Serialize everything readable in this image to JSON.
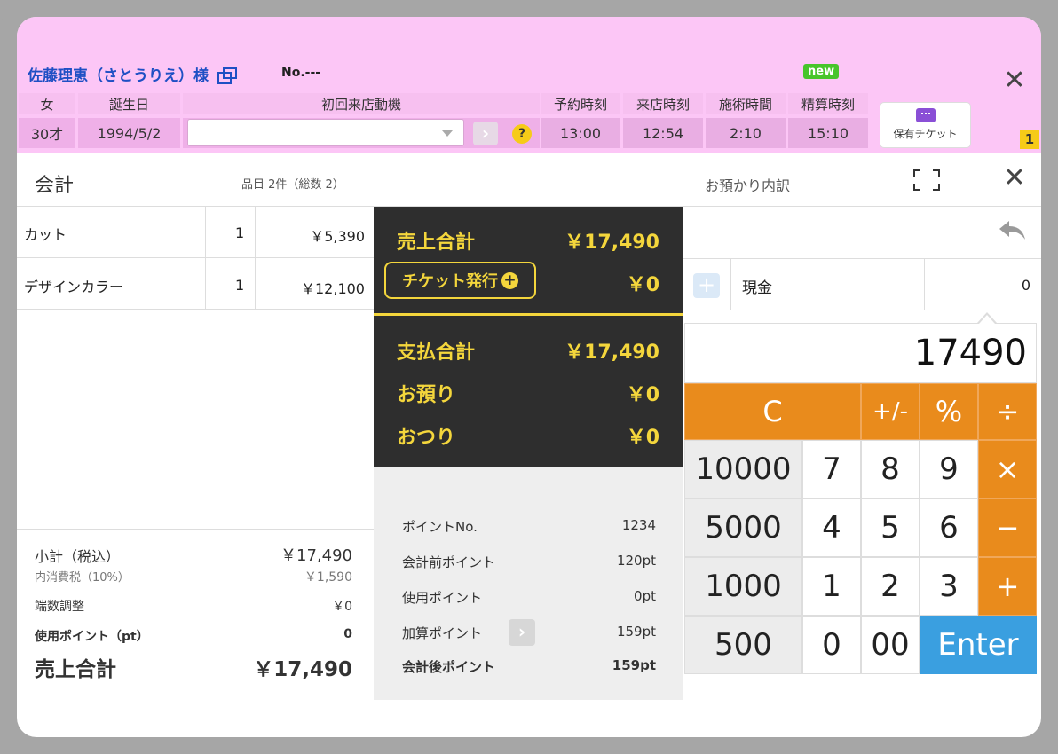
{
  "customer": {
    "name": "佐藤理恵（さとうりえ）様",
    "no": "No.---",
    "new_badge": "new",
    "headers": [
      "女",
      "誕生日",
      "初回来店動機",
      "予約時刻",
      "来店時刻",
      "施術時間",
      "精算時刻"
    ],
    "age": "30才",
    "birthday": "1994/5/2",
    "visit_motive": "",
    "reserve_time": "13:00",
    "arrival_time": "12:54",
    "treatment_time": "2:10",
    "settle_time": "15:10",
    "ticket_button": "保有チケット",
    "ticket_count": "1"
  },
  "checkout": {
    "title": "会計",
    "items_count": "品目 2件（総数 2）",
    "deposit_title": "お預かり内訳",
    "items": [
      {
        "name": "カット",
        "qty": "1",
        "price": "￥5,390"
      },
      {
        "name": "デザインカラー",
        "qty": "1",
        "price": "￥12,100"
      }
    ],
    "summary": {
      "subtotal_label": "小計（税込）",
      "subtotal": "￥17,490",
      "tax_label": "内消費税（10%）",
      "tax": "￥1,590",
      "rounding_label": "端数調整",
      "rounding": "￥0",
      "used_points_label": "使用ポイント（pt）",
      "used_points": "0",
      "total_label": "売上合計",
      "total": "￥17,490"
    }
  },
  "totals": {
    "sales_total_label": "売上合計",
    "sales_total": "￥17,490",
    "ticket_issue_label": "チケット発行",
    "ticket_issue": "￥0",
    "payment_total_label": "支払合計",
    "payment_total": "￥17,490",
    "deposit_label": "お預り",
    "deposit": "￥0",
    "change_label": "おつり",
    "change": "￥0"
  },
  "points": {
    "point_no_label": "ポイントNo.",
    "point_no": "1234",
    "before_label": "会計前ポイント",
    "before": "120pt",
    "used_label": "使用ポイント",
    "used": "0pt",
    "added_label": "加算ポイント",
    "added": "159pt",
    "after_label": "会計後ポイント",
    "after": "159pt"
  },
  "payment": {
    "method": "現金",
    "amount": "0",
    "display": "17490"
  },
  "keypad": {
    "clear": "C",
    "sign": "+/-",
    "percent": "%",
    "divide": "÷",
    "k10000": "10000",
    "k7": "7",
    "k8": "8",
    "k9": "9",
    "multiply": "×",
    "k5000": "5000",
    "k4": "4",
    "k5": "5",
    "k6": "6",
    "minus": "−",
    "k1000": "1000",
    "k1": "1",
    "k2": "2",
    "k3": "3",
    "plus": "+",
    "k500": "500",
    "k0": "0",
    "k00": "00",
    "enter": "Enter"
  },
  "colors": {
    "header_bg": "#fcc6f6",
    "accent_yellow": "#f4d63c",
    "keypad_orange": "#e98b1c",
    "enter_blue": "#3a9fe0",
    "name_blue": "#1e4fc4"
  }
}
